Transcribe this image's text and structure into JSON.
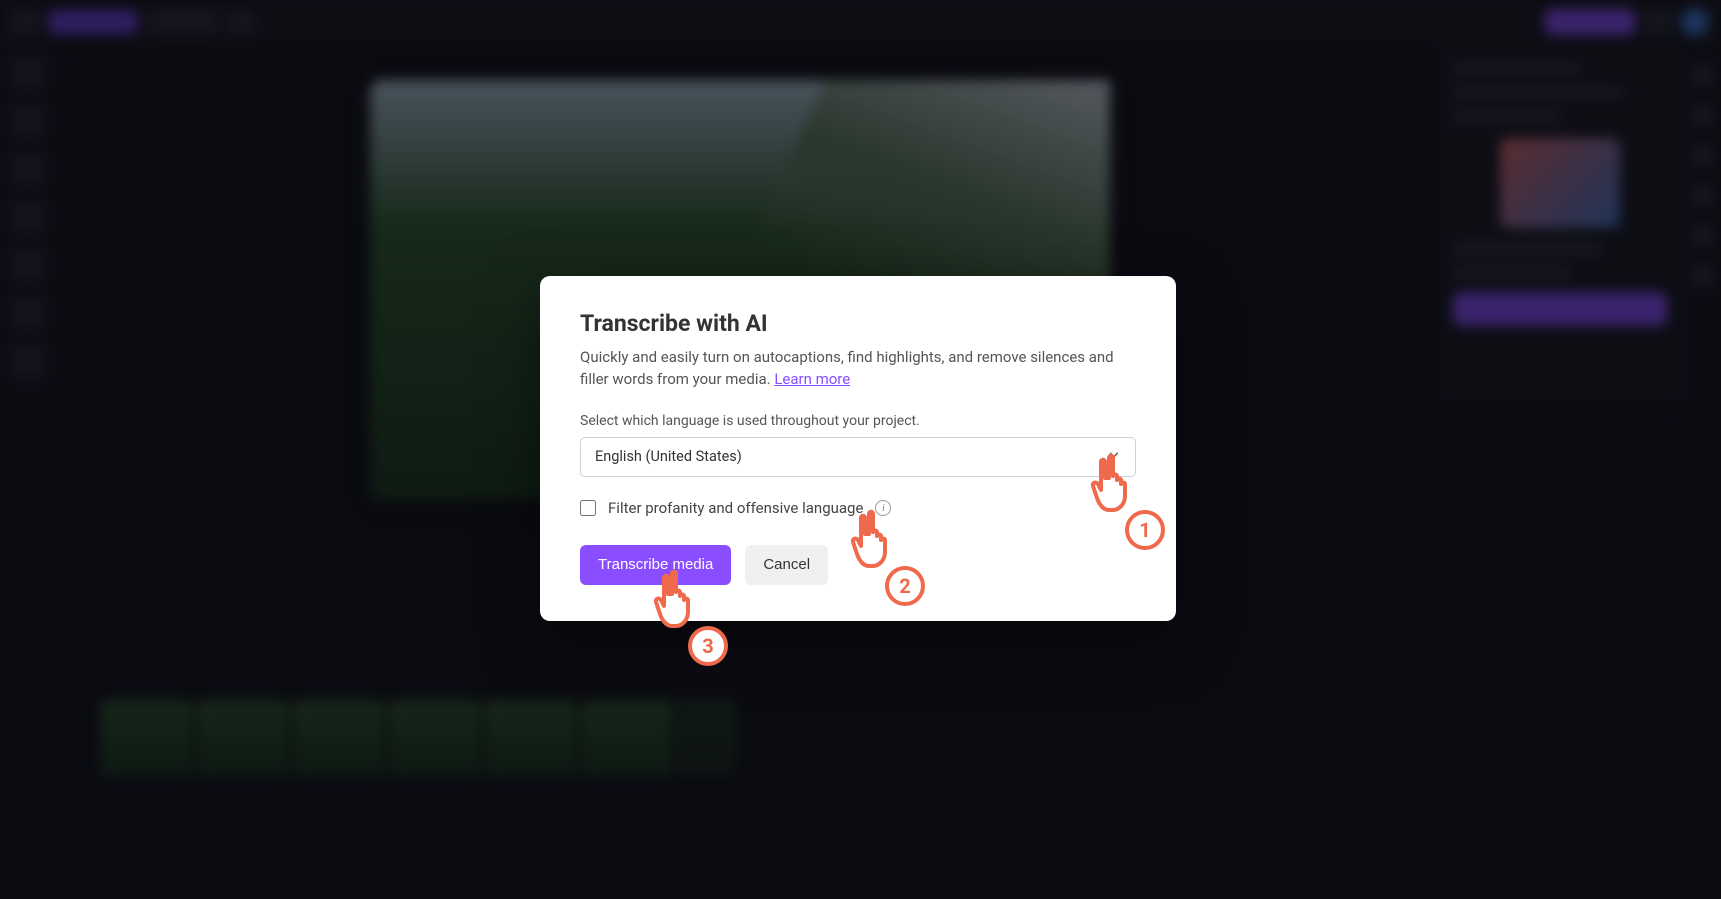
{
  "modal": {
    "title": "Transcribe with AI",
    "description_prefix": "Quickly and easily turn on autocaptions, find highlights, and remove silences and filler words from your media. ",
    "learn_more_label": "Learn more",
    "language_label": "Select which language is used throughout your project.",
    "language_selected": "English (United States)",
    "filter_label": "Filter profanity and offensive language",
    "transcribe_button": "Transcribe media",
    "cancel_button": "Cancel"
  },
  "annotations": {
    "pointer_1": "1",
    "pointer_2": "2",
    "pointer_3": "3"
  },
  "colors": {
    "accent": "#8a4dff",
    "annotation": "#ef6a4c"
  }
}
